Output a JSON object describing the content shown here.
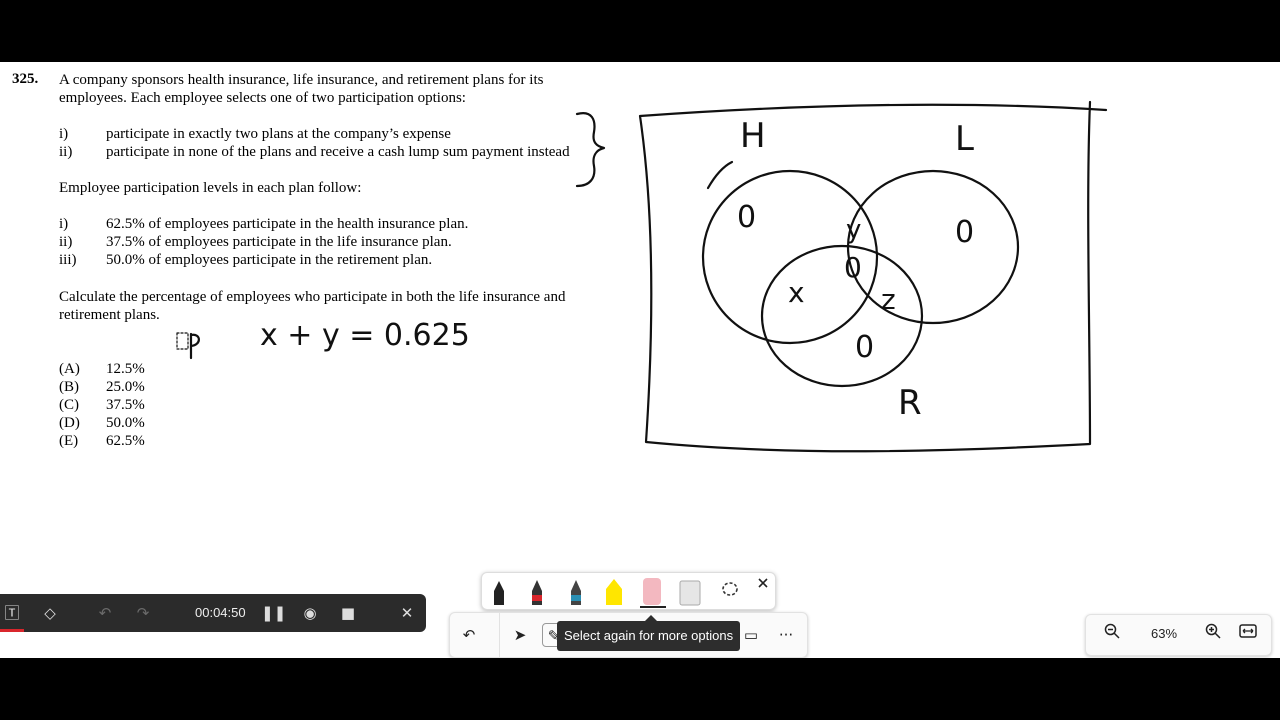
{
  "problem": {
    "number": "325.",
    "intro_lines": [
      "A company sponsors health insurance, life insurance, and retirement plans for its",
      "employees.  Each employee selects one of two participation options:"
    ],
    "options": [
      {
        "label": "i)",
        "text": "participate in exactly two plans at the company’s expense"
      },
      {
        "label": "ii)",
        "text": "participate in none of the plans and receive a cash lump sum payment instead"
      }
    ],
    "levels_heading": "Employee participation levels in each plan follow:",
    "levels": [
      {
        "label": "i)",
        "text": "62.5% of employees participate in the health insurance plan."
      },
      {
        "label": "ii)",
        "text": "37.5% of employees participate in the life insurance plan."
      },
      {
        "label": "iii)",
        "text": "50.0% of employees participate in the retirement plan."
      }
    ],
    "question_lines": [
      "Calculate the percentage of employees who participate in both the life insurance and",
      "retirement plans."
    ],
    "answers": [
      {
        "label": "(A)",
        "value": "12.5%"
      },
      {
        "label": "(B)",
        "value": "25.0%"
      },
      {
        "label": "(C)",
        "value": "37.5%"
      },
      {
        "label": "(D)",
        "value": "50.0%"
      },
      {
        "label": "(E)",
        "value": "62.5%"
      }
    ]
  },
  "annotations": {
    "equation": "x + y = 0.625",
    "venn_labels": {
      "h": "H",
      "l": "L",
      "r": "R"
    },
    "region_values": {
      "h_only": "0",
      "l_only": "0",
      "r_only": "0",
      "hl": "y",
      "center": "0",
      "hr": "x",
      "lr": "z"
    }
  },
  "recorder": {
    "time": "00:04:50"
  },
  "toolbar": {
    "tooltip": "Select again for more options",
    "more": "···"
  },
  "zoom": {
    "level": "63%"
  },
  "colors": {
    "pen_red": "#d9262c",
    "pen_teal": "#2b8fb3",
    "highlighter": "#ffe600"
  }
}
